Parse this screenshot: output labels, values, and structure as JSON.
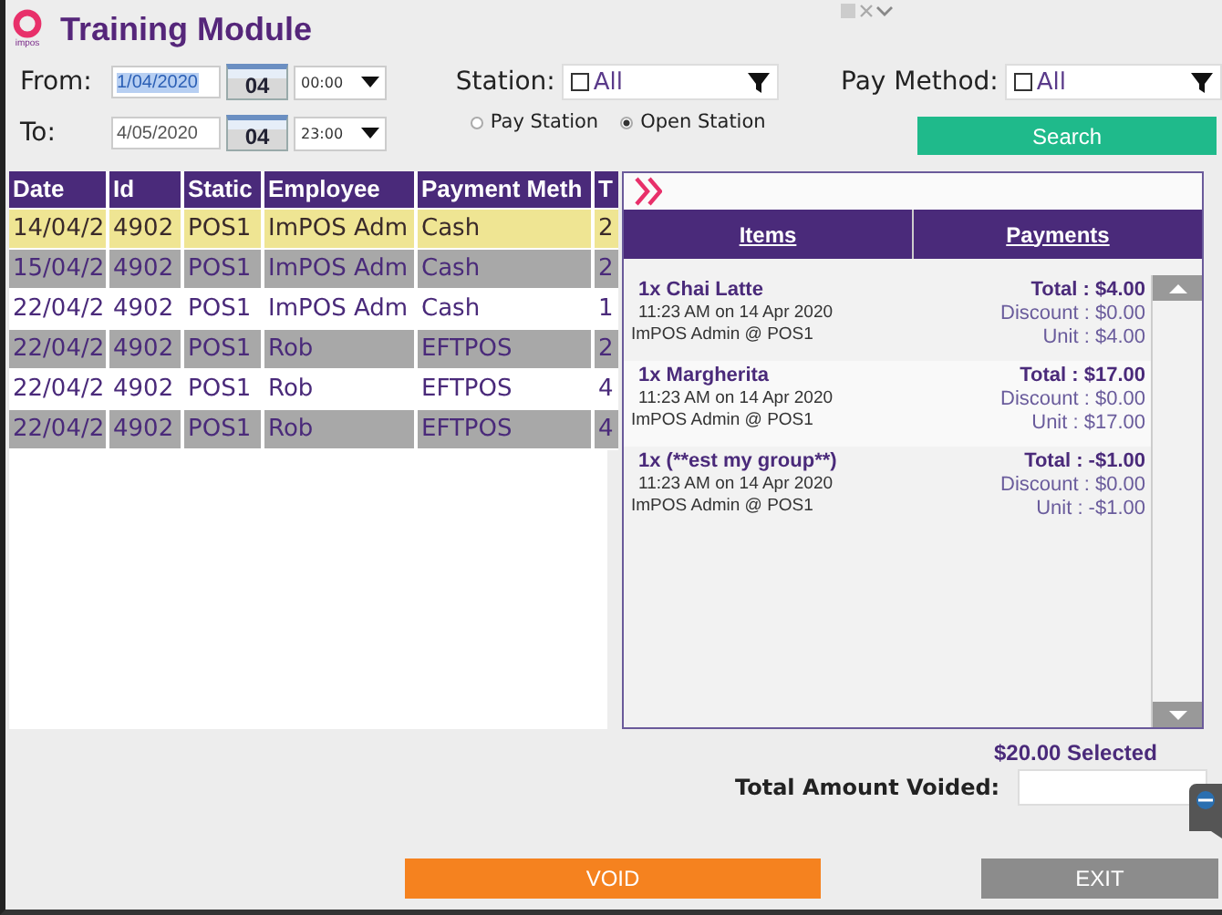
{
  "window": {
    "title": "Training Module",
    "logo_text": "impos"
  },
  "filters": {
    "from": {
      "label": "From:",
      "date": "1/04/2020",
      "text_selected": true,
      "day": "04",
      "time": "00:00"
    },
    "to": {
      "label": "To:",
      "date": "4/05/2020",
      "text_selected": false,
      "day": "04",
      "time": "23:00"
    },
    "station": {
      "label": "Station:",
      "checked": false,
      "value": "All"
    },
    "station_modes": [
      {
        "label": "Pay Station",
        "selected": false
      },
      {
        "label": "Open Station",
        "selected": true
      }
    ],
    "pay_method": {
      "label": "Pay Method:",
      "checked": false,
      "value": "All"
    },
    "search_button": "Search"
  },
  "table": {
    "columns": [
      "Date",
      "Id",
      "Static",
      "Employee",
      "Payment Meth",
      "T"
    ],
    "rows": [
      {
        "cells": [
          "14/04/2",
          "4902",
          "POS1",
          "ImPOS Adm",
          "Cash",
          "2"
        ],
        "current": true,
        "selected": false
      },
      {
        "cells": [
          "15/04/2",
          "4902",
          "POS1",
          "ImPOS Adm",
          "Cash",
          "2"
        ],
        "current": false,
        "selected": true
      },
      {
        "cells": [
          "22/04/2",
          "4902",
          "POS1",
          "ImPOS Adm",
          "Cash",
          "1"
        ],
        "current": false,
        "selected": false
      },
      {
        "cells": [
          "22/04/2",
          "4902",
          "POS1",
          "Rob",
          "EFTPOS",
          "2"
        ],
        "current": false,
        "selected": true
      },
      {
        "cells": [
          "22/04/2",
          "4902",
          "POS1",
          "Rob",
          "EFTPOS",
          "4"
        ],
        "current": false,
        "selected": false
      },
      {
        "cells": [
          "22/04/2",
          "4902",
          "POS1",
          "Rob",
          "EFTPOS",
          "4"
        ],
        "current": false,
        "selected": true
      }
    ]
  },
  "details": {
    "tabs": [
      {
        "label": "Items"
      },
      {
        "label": "Payments"
      }
    ],
    "items": [
      {
        "name": "1x Chai Latte",
        "time": "11:23 AM on 14 Apr 2020",
        "by": "ImPOS Admin @ POS1",
        "total": "Total : $4.00",
        "discount": "Discount : $0.00",
        "unit": "Unit : $4.00"
      },
      {
        "name": "1x Margherita",
        "time": "11:23 AM on 14 Apr 2020",
        "by": "ImPOS Admin @ POS1",
        "total": "Total : $17.00",
        "discount": "Discount : $0.00",
        "unit": "Unit : $17.00"
      },
      {
        "name": "1x (**est my group**)",
        "time": "11:23 AM on 14 Apr 2020",
        "by": "ImPOS Admin @ POS1",
        "total": "Total : -$1.00",
        "discount": "Discount : $0.00",
        "unit": "Unit : -$1.00"
      }
    ]
  },
  "summary": {
    "selected": "$20.00 Selected",
    "voided_label": "Total Amount Voided:"
  },
  "buttons": [
    {
      "label": "VOID",
      "kind": "void"
    },
    {
      "label": "EXIT",
      "kind": "exit"
    }
  ]
}
